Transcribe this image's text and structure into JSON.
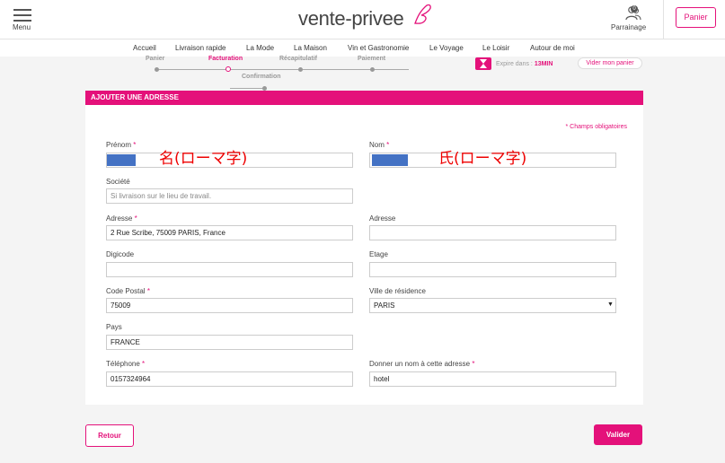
{
  "header": {
    "menu_label": "Menu",
    "logo_text": "vente-privee",
    "parrainage_label": "Parrainage",
    "parrainage_count": "0",
    "panier_label": "Panier"
  },
  "nav": {
    "items": [
      "Accueil",
      "Livraison rapide",
      "La Mode",
      "La Maison",
      "Vin et Gastronomie",
      "Le Voyage",
      "Le Loisir",
      "Autour de moi"
    ]
  },
  "stepper": {
    "steps": [
      "Panier",
      "Facturation",
      "Récapitulatif",
      "Paiement"
    ],
    "confirmation": "Confirmation",
    "timer_label": "Expire dans :",
    "timer_value": "13MIN",
    "empty_cart": "Vider mon panier"
  },
  "form": {
    "title": "AJOUTER UNE ADRESSE",
    "required_note": "* Champs obligatoires",
    "prenom_label": "Prénom",
    "nom_label": "Nom",
    "prenom_note": "名(ローマ字)",
    "nom_note": "氏(ローマ字)",
    "societe_label": "Société",
    "societe_placeholder": "Si livraison sur le lieu de travail.",
    "adresse_label": "Adresse",
    "adresse_value": "2 Rue Scribe, 75009 PARIS, France",
    "adresse2_label": "Adresse",
    "digicode_label": "Digicode",
    "etage_label": "Etage",
    "code_postal_label": "Code Postal",
    "code_postal_value": "75009",
    "ville_label": "Ville de résidence",
    "ville_value": "PARIS",
    "pays_label": "Pays",
    "pays_value": "FRANCE",
    "telephone_label": "Téléphone",
    "telephone_value": "0157324964",
    "nom_adresse_label": "Donner un nom à cette adresse",
    "nom_adresse_value": "hotel",
    "required_mark": "*"
  },
  "buttons": {
    "retour": "Retour",
    "valider": "Valider"
  },
  "colors": {
    "accent": "#e4117a",
    "redaction": "#4472c4",
    "annotation": "#ee0000"
  }
}
